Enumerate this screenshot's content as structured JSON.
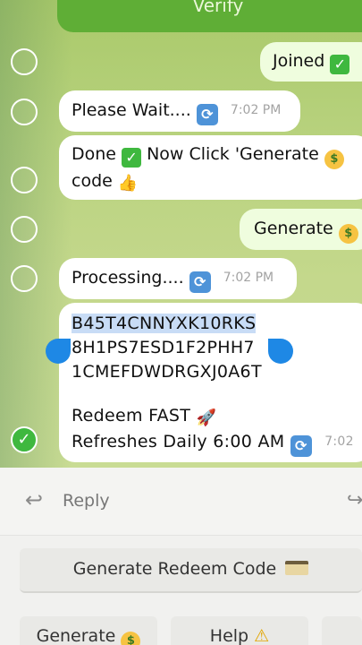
{
  "header": {
    "verify_label": "Verify"
  },
  "messages": {
    "joined": "Joined",
    "please_wait": "Please Wait....",
    "please_wait_time": "7:02 PM",
    "done_text_a": "Done",
    "done_text_b": "Now Click 'Generate",
    "done_text_c": "code",
    "generate": "Generate",
    "processing": "Processing....",
    "processing_time": "7:02 PM",
    "code_line_1": "B45T4CNNYXK10RKS",
    "code_line_2": "8H1PS7ESD1F2PHH7",
    "code_line_3": "1CMEFDWDRGXJ0A6T",
    "redeem_line": "Redeem FAST",
    "refresh_line": "Refreshes Daily 6:00 AM",
    "code_time": "7:02"
  },
  "reply_bar": {
    "label": "Reply"
  },
  "keyboard": {
    "main_button": "Generate Redeem Code",
    "btn_generate": "Generate",
    "btn_help": "Help"
  },
  "colors": {
    "accent_green": "#5fae36",
    "bubble_white": "#ffffff",
    "selection_blue": "#1e88e5"
  },
  "icons": {
    "check": "check-mark-emoji-icon",
    "refresh": "refresh-emoji-icon",
    "money_face": "money-face-emoji-icon",
    "thumbs_up": "thumbs-up-emoji-icon",
    "rocket": "rocket-emoji-icon",
    "reply": "reply-arrow-icon",
    "card": "credit-card-icon",
    "warning": "warning-icon"
  }
}
